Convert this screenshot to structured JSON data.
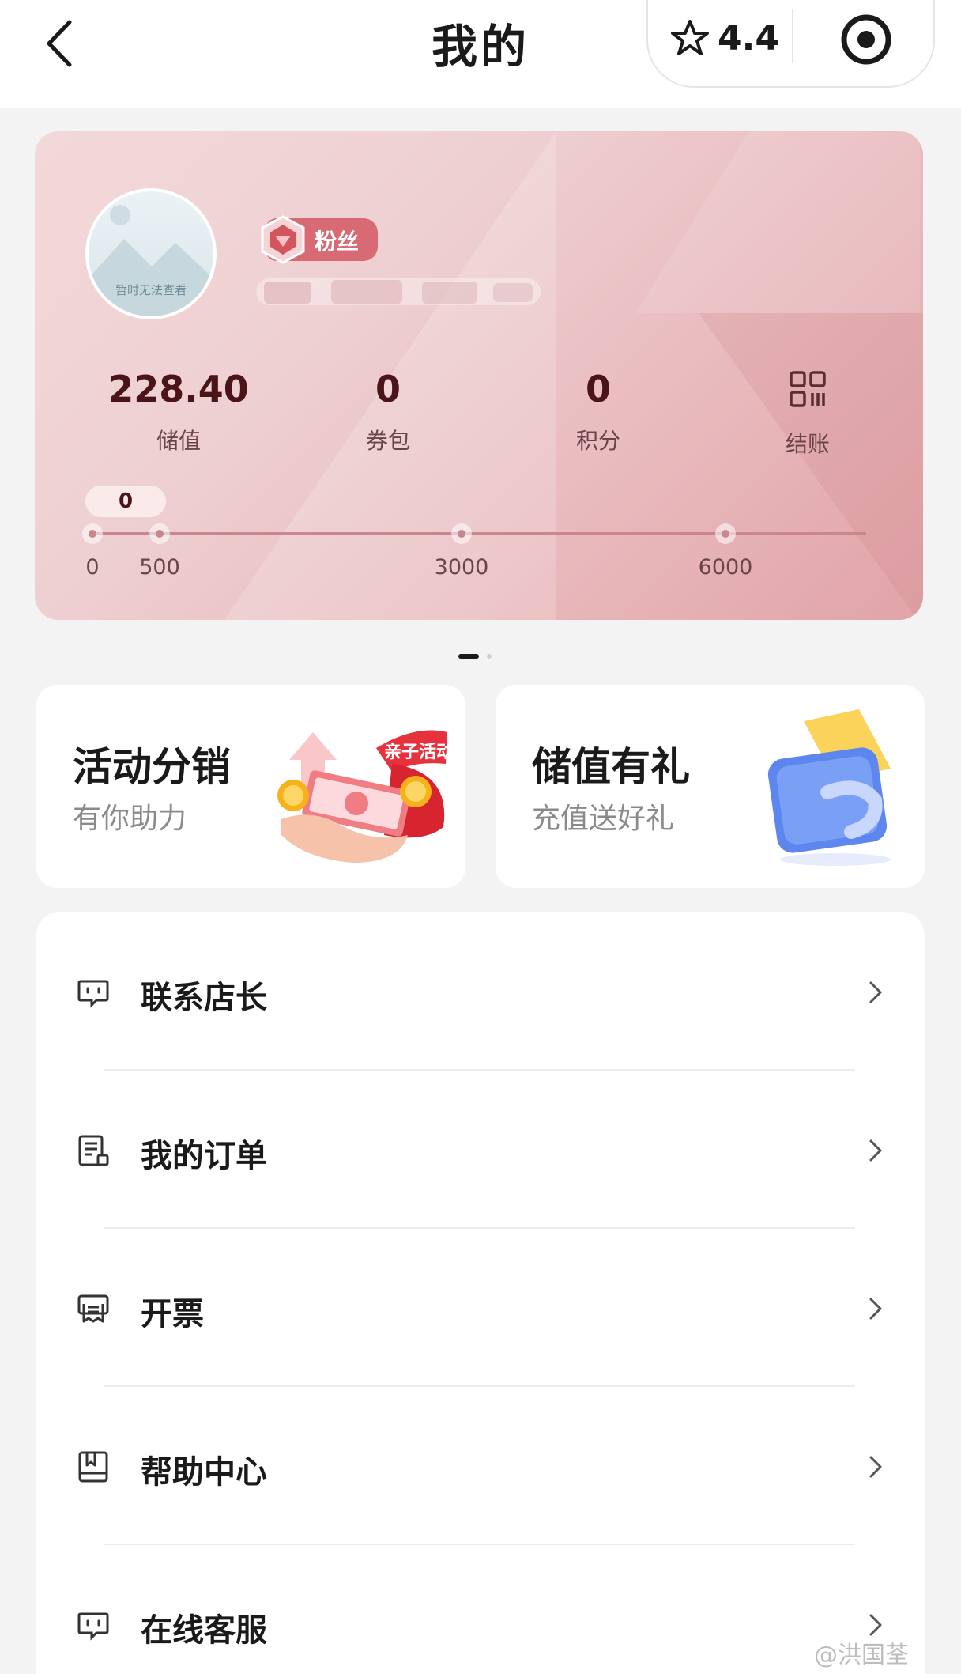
{
  "header": {
    "title": "我的",
    "rating": "4.4"
  },
  "member_card": {
    "avatar_caption": "暂时无法查看",
    "badge": "粉丝",
    "stats": [
      {
        "value": "228.40",
        "label": "储值"
      },
      {
        "value": "0",
        "label": "券包"
      },
      {
        "value": "0",
        "label": "积分"
      },
      {
        "label": "结账",
        "icon": "qr-code-icon"
      }
    ],
    "progress": {
      "current": "0",
      "milestones": [
        "0",
        "500",
        "3000",
        "6000"
      ]
    }
  },
  "promos": [
    {
      "title": "活动分销",
      "subtitle": "有你助力",
      "tag": "亲子活动"
    },
    {
      "title": "储值有礼",
      "subtitle": "充值送好礼"
    }
  ],
  "menu": [
    {
      "label": "联系店长",
      "icon": "chat-icon"
    },
    {
      "label": "我的订单",
      "icon": "order-icon"
    },
    {
      "label": "开票",
      "icon": "invoice-icon"
    },
    {
      "label": "帮助中心",
      "icon": "help-book-icon"
    },
    {
      "label": "在线客服",
      "icon": "chat-icon"
    }
  ],
  "watermark": "@洪国荃",
  "colors": {
    "accent": "#d76a72",
    "card_dark_text": "#4a1418"
  }
}
